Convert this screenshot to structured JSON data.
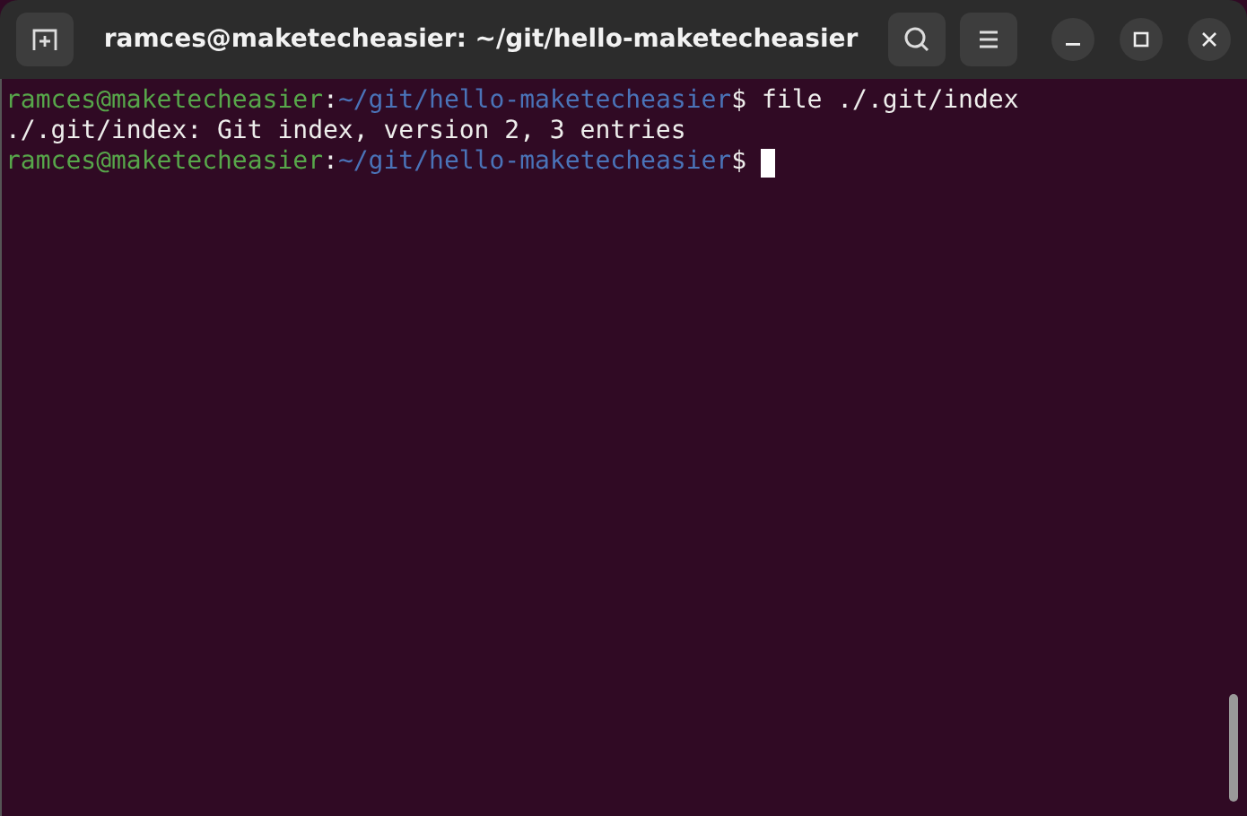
{
  "window": {
    "title": "ramces@maketecheasier: ~/git/hello-maketecheasier"
  },
  "terminal": {
    "lines": [
      {
        "kind": "prompt",
        "user": "ramces@maketecheasier",
        "separator": ":",
        "path": "~/git/hello-maketecheasier",
        "symbol": "$",
        "command": " file ./.git/index",
        "cursor": false
      },
      {
        "kind": "output",
        "text": "./.git/index: Git index, version 2, 3 entries"
      },
      {
        "kind": "prompt",
        "user": "ramces@maketecheasier",
        "separator": ":",
        "path": "~/git/hello-maketecheasier",
        "symbol": "$",
        "cursor": true
      }
    ]
  }
}
